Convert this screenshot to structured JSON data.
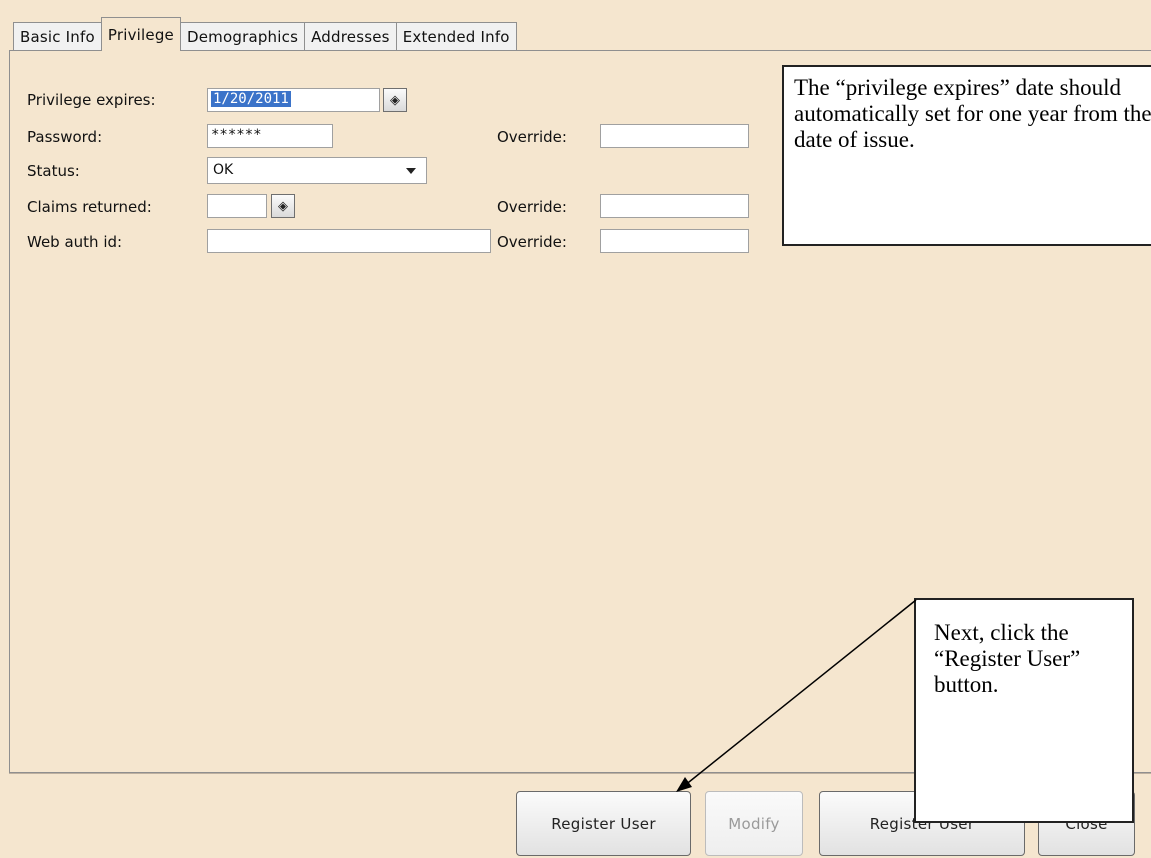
{
  "tabs": [
    "Basic Info",
    "Privilege",
    "Demographics",
    "Addresses",
    "Extended Info"
  ],
  "active_tab": "Privilege",
  "form": {
    "privilege_expires_label": "Privilege expires:",
    "privilege_expires_value": "1/20/2011",
    "password_label": "Password:",
    "password_value": "******",
    "status_label": "Status:",
    "status_value": "OK",
    "claims_returned_label": "Claims returned:",
    "claims_returned_value": "",
    "web_auth_label": "Web auth id:",
    "web_auth_value": "",
    "override_label": "Override:",
    "override_password_value": "",
    "override_claims_value": "",
    "override_web_value": ""
  },
  "annotations": {
    "note1": "The “privilege expires” date should automatically set for one year from the date of issue.",
    "note2": "Next, click the “Register User” button."
  },
  "buttons": {
    "register_user": "Register User",
    "modify": "Modify",
    "register_another": "Register User",
    "close": "Close"
  }
}
